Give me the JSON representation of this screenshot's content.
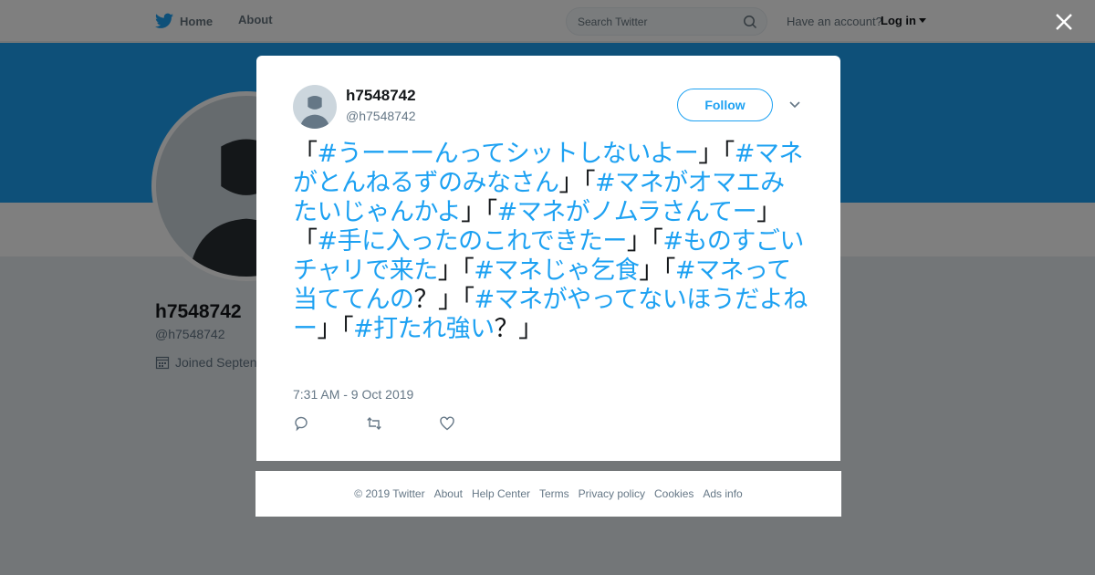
{
  "nav": {
    "home": "Home",
    "about": "About"
  },
  "search": {
    "placeholder": "Search Twitter"
  },
  "account": {
    "prompt": "Have an account?",
    "login": "Log in"
  },
  "profile": {
    "name": "h7548742",
    "handle": "@h7548742",
    "joined": "Joined Septen"
  },
  "tweet": {
    "name": "h7548742",
    "handle": "@h7548742",
    "follow": "Follow",
    "segments": [
      {
        "t": "「",
        "tag": false
      },
      {
        "t": "#うーーーんってシットしないよー",
        "tag": true
      },
      {
        "t": "」「",
        "tag": false
      },
      {
        "t": "#マネがとんねるずのみなさん",
        "tag": true
      },
      {
        "t": "」「",
        "tag": false
      },
      {
        "t": "#マネがオマエみたいじゃんかよ",
        "tag": true
      },
      {
        "t": "」「",
        "tag": false
      },
      {
        "t": "#マネがノムラさんてー",
        "tag": true
      },
      {
        "t": "」「",
        "tag": false
      },
      {
        "t": "#手に入ったのこれできたー",
        "tag": true
      },
      {
        "t": "」「",
        "tag": false
      },
      {
        "t": "#ものすごいチャリで来た",
        "tag": true
      },
      {
        "t": "」「",
        "tag": false
      },
      {
        "t": "#マネじゃ乞食",
        "tag": true
      },
      {
        "t": "」「",
        "tag": false
      },
      {
        "t": "#マネって当ててんの",
        "tag": true
      },
      {
        "t": "？」「",
        "tag": false
      },
      {
        "t": "#マネがやってないほうだよねー",
        "tag": true
      },
      {
        "t": "」「",
        "tag": false
      },
      {
        "t": "#打たれ強い",
        "tag": true
      },
      {
        "t": "？」",
        "tag": false
      }
    ],
    "timestamp": "7:31 AM - 9 Oct 2019"
  },
  "footer": {
    "copyright": "© 2019 Twitter",
    "links": [
      "About",
      "Help Center",
      "Terms",
      "Privacy policy",
      "Cookies",
      "Ads info"
    ]
  },
  "colors": {
    "accent": "#1da1f2",
    "banner": "#1da1f2",
    "text": "#14171a",
    "muted": "#657786"
  },
  "icons": [
    "twitter-bird-icon",
    "search-icon",
    "close-icon",
    "chevron-down-icon",
    "calendar-icon",
    "reply-icon",
    "retweet-icon",
    "like-icon"
  ]
}
